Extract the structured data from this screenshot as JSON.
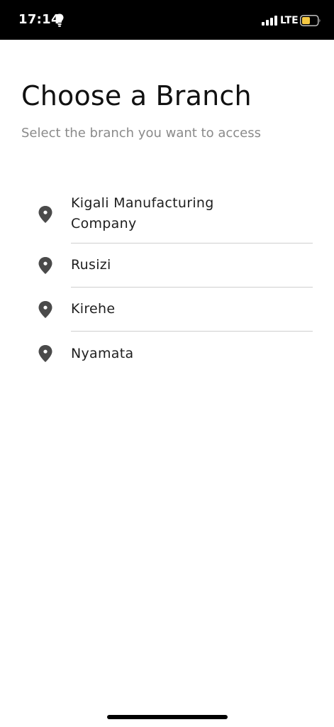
{
  "status_bar": {
    "time": "17:14",
    "network": "LTE",
    "icons": [
      "lightbulb-icon",
      "signal-icon",
      "battery-icon"
    ],
    "battery_color": "#f5c842"
  },
  "header": {
    "title": "Choose a Branch",
    "subtitle": "Select the branch you want to access"
  },
  "branches": [
    {
      "label": "Kigali Manufacturing Company",
      "icon": "location-pin-icon"
    },
    {
      "label": "Rusizi",
      "icon": "location-pin-icon"
    },
    {
      "label": "Kirehe",
      "icon": "location-pin-icon"
    },
    {
      "label": "Nyamata",
      "icon": "location-pin-icon"
    }
  ],
  "colors": {
    "title": "#111111",
    "subtitle": "#8a8a8a",
    "icon": "#4a4a4a",
    "divider": "#cfcfcf"
  }
}
